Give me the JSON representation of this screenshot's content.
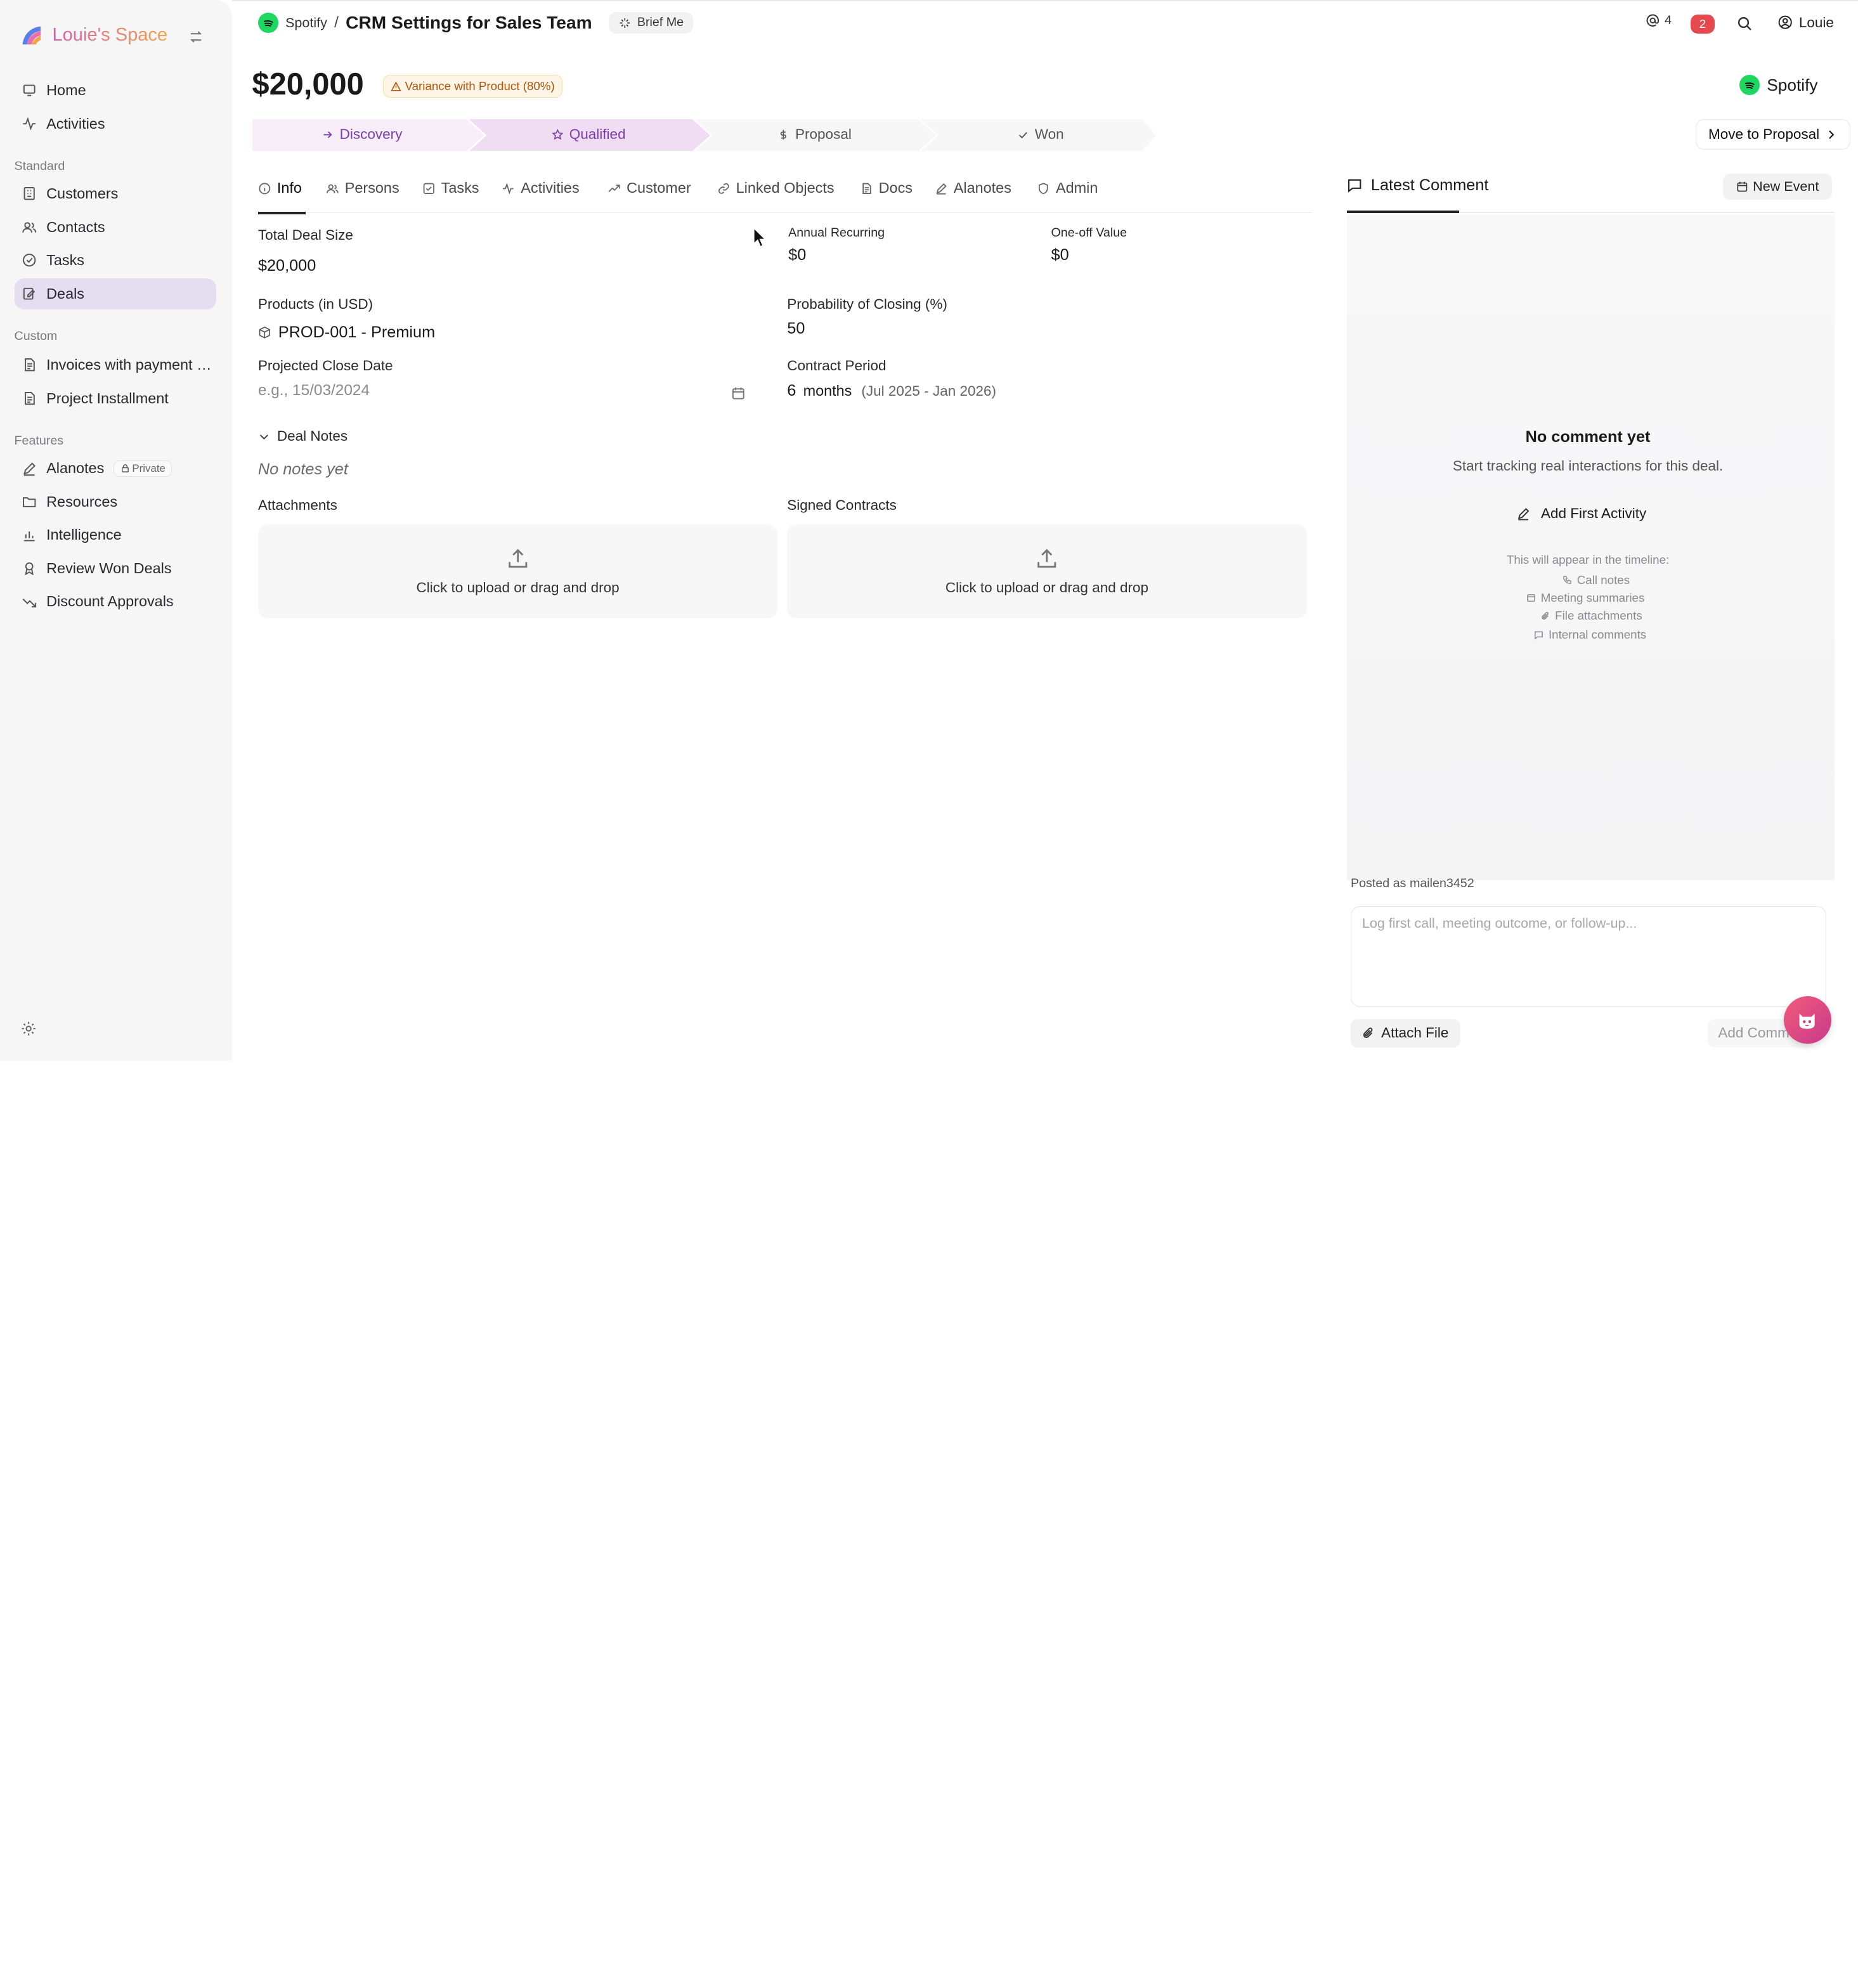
{
  "brand": {
    "name": "Louie's Space"
  },
  "sidebar": {
    "items": [
      {
        "label": "Home",
        "icon": "home-icon"
      },
      {
        "label": "Activities",
        "icon": "activity-icon"
      }
    ],
    "standard_label": "Standard",
    "standard": [
      {
        "label": "Customers",
        "icon": "building-icon"
      },
      {
        "label": "Contacts",
        "icon": "users-icon"
      },
      {
        "label": "Tasks",
        "icon": "check-circle-icon"
      },
      {
        "label": "Deals",
        "icon": "deal-icon",
        "active": true
      }
    ],
    "custom_label": "Custom",
    "custom": [
      {
        "label": "Invoices with payment …",
        "icon": "document-icon"
      },
      {
        "label": "Project Installment",
        "icon": "document-icon"
      }
    ],
    "features_label": "Features",
    "features": [
      {
        "label": "Alanotes",
        "icon": "pen-icon",
        "badge": "Private"
      },
      {
        "label": "Resources",
        "icon": "folder-icon"
      },
      {
        "label": "Intelligence",
        "icon": "bar-chart-icon"
      },
      {
        "label": "Review Won Deals",
        "icon": "award-icon"
      },
      {
        "label": "Discount Approvals",
        "icon": "trend-down-icon"
      }
    ]
  },
  "header": {
    "company": "Spotify",
    "separator": "/",
    "title": "CRM Settings for Sales Team",
    "brief_label": "Brief Me",
    "mentions_count": "4",
    "notifications_count": "2",
    "user_name": "Louie"
  },
  "deal": {
    "amount": "$20,000",
    "variance_label": "Variance with Product (80%)",
    "company": "Spotify"
  },
  "pipeline": {
    "stages": [
      {
        "label": "Discovery",
        "state": "done"
      },
      {
        "label": "Qualified",
        "state": "current"
      },
      {
        "label": "Proposal",
        "state": "upcoming"
      },
      {
        "label": "Won",
        "state": "upcoming"
      }
    ],
    "move_label": "Move to Proposal"
  },
  "tabs": [
    {
      "label": "Info",
      "active": true
    },
    {
      "label": "Persons"
    },
    {
      "label": "Tasks"
    },
    {
      "label": "Activities"
    },
    {
      "label": "Customer"
    },
    {
      "label": "Linked Objects"
    },
    {
      "label": "Docs"
    },
    {
      "label": "Alanotes"
    },
    {
      "label": "Admin"
    }
  ],
  "info": {
    "total_deal_size_label": "Total Deal Size",
    "total_deal_size": "$20,000",
    "annual_recurring_label": "Annual Recurring",
    "annual_recurring": "$0",
    "one_off_label": "One-off Value",
    "one_off": "$0",
    "products_label": "Products (in USD)",
    "product": "PROD-001 - Premium",
    "probability_label": "Probability of Closing (%)",
    "probability": "50",
    "close_date_label": "Projected Close Date",
    "close_date_placeholder": "e.g., 15/03/2024",
    "contract_period_label": "Contract Period",
    "contract_months": "6",
    "contract_unit": "months",
    "contract_range": "(Jul 2025 - Jan 2026)",
    "deal_notes_label": "Deal Notes",
    "no_notes": "No notes yet",
    "attachments_label": "Attachments",
    "signed_contracts_label": "Signed Contracts",
    "upload_text": "Click to upload or drag and drop"
  },
  "comments": {
    "title": "Latest Comment",
    "new_event_label": "New Event",
    "empty_title": "No comment yet",
    "empty_sub": "Start tracking real interactions for this deal.",
    "add_first_label": "Add First Activity",
    "timeline_note": "This will appear in the timeline:",
    "timeline_items": [
      "Call notes",
      "Meeting summaries",
      "File attachments",
      "Internal comments"
    ],
    "posted_as": "Posted as mailen3452",
    "input_placeholder": "Log first call, meeting outcome, or follow-up...",
    "attach_label": "Attach File",
    "add_comment_label": "Add Comm"
  },
  "colors": {
    "accent_purple": "#7b3fb0",
    "stage_done_bg": "#f7eefa",
    "stage_current_bg": "#f0dcf3",
    "stage_upcoming_bg": "#f6f6f7",
    "notification_red": "#e5484d",
    "spotify_green": "#1ed760",
    "sidebar_active": "#e5def0"
  }
}
